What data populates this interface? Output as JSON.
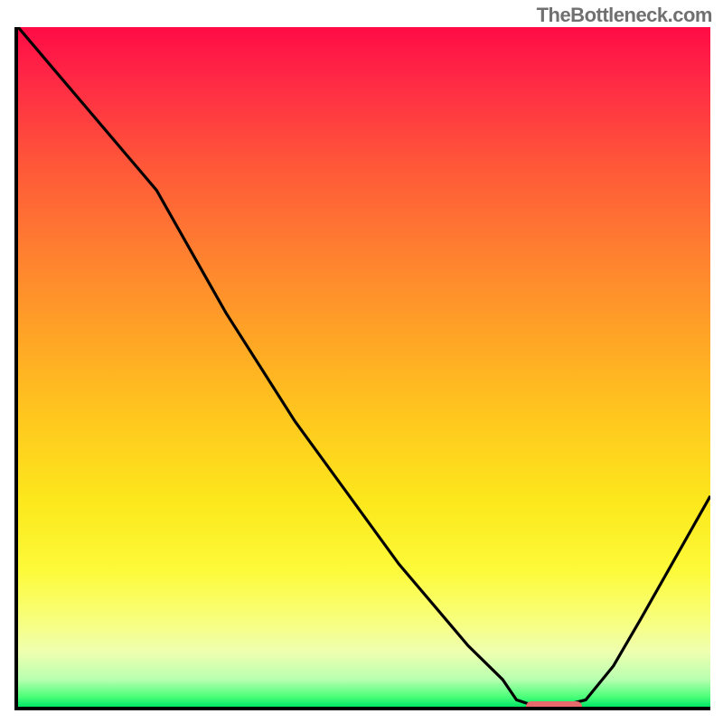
{
  "watermark": "TheBottleneck.com",
  "colors": {
    "gradient_top": "#ff0b45",
    "gradient_bottom": "#00e765",
    "curve": "#000000",
    "marker": "#e86a6c",
    "axis": "#000000"
  },
  "chart_data": {
    "type": "line",
    "title": "",
    "xlabel": "",
    "ylabel": "",
    "xlim": [
      0,
      100
    ],
    "ylim": [
      0,
      100
    ],
    "x": [
      0,
      5,
      10,
      15,
      20,
      25,
      30,
      35,
      40,
      45,
      50,
      55,
      60,
      65,
      70,
      72,
      75,
      78,
      82,
      86,
      90,
      95,
      100
    ],
    "y": [
      100,
      94,
      88,
      82,
      76,
      67,
      58,
      50,
      42,
      35,
      28,
      21,
      15,
      9,
      4,
      1,
      0,
      0,
      1,
      6,
      13,
      22,
      31
    ],
    "marker": {
      "x_start": 73,
      "x_end": 81,
      "y": 0
    },
    "annotations": []
  }
}
